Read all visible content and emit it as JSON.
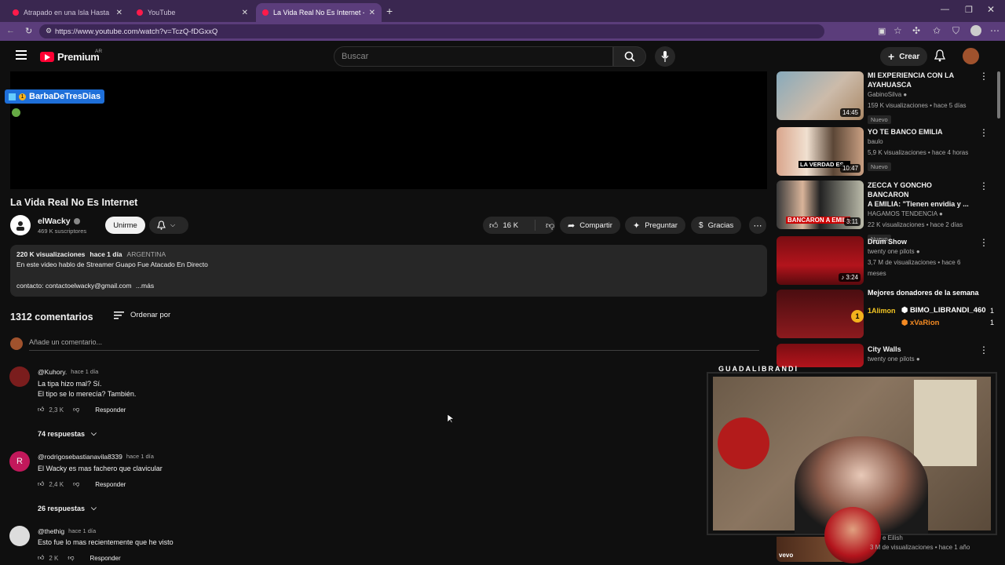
{
  "browser": {
    "tabs": [
      {
        "label": "Atrapado en una Isla Hasta que C"
      },
      {
        "label": "YouTube"
      },
      {
        "label": "La Vida Real No Es Internet - YouT"
      }
    ],
    "url": "https://www.youtube.com/watch?v=TczQ-fDGxxQ"
  },
  "header": {
    "brand": "Premium",
    "region": "AR",
    "search_placeholder": "Buscar",
    "create_label": "Crear"
  },
  "overlay": {
    "stream_name": "BarbaDeTresDias",
    "badge_num": "1",
    "webcam_title": "GUADALIBRANDI"
  },
  "video": {
    "title": "La Vida Real No Es Internet",
    "channel": "elWacky",
    "subscribers": "469 K suscriptores",
    "join_label": "Unirme",
    "likes": "16 K",
    "share_label": "Compartir",
    "ask_label": "Preguntar",
    "thanks_label": "Gracias"
  },
  "description": {
    "views": "220 K visualizaciones",
    "date": "hace 1 día",
    "country": "ARGENTINA",
    "line1": "En este video hablo de Streamer Guapo Fue Atacado En Directo",
    "line2": "contacto: contactoelwacky@gmail.com",
    "more": "...más"
  },
  "comments": {
    "count_label": "1312 comentarios",
    "sort_label": "Ordenar por",
    "add_placeholder": "Añade un comentario...",
    "reply_label": "Responder",
    "items": [
      {
        "author": "@Kuhory.",
        "time": "hace 1 día",
        "lines": [
          "La tipa hizo mal? Sí.",
          "El tipo se lo merecía? También."
        ],
        "likes": "2,3 K",
        "replies": "74 respuestas"
      },
      {
        "author": "@rodrigosebastianavila8339",
        "time": "hace 1 día",
        "lines": [
          "El Wacky es mas fachero que clavicular"
        ],
        "likes": "2,4 K",
        "replies": "26 respuestas"
      },
      {
        "author": "@thethig",
        "time": "hace 1 día",
        "lines": [
          "Esto fue lo mas recientemente que he visto"
        ],
        "likes": "2 K",
        "replies": ""
      }
    ]
  },
  "recommendations": [
    {
      "title1": "MI EXPERIENCIA CON LA",
      "title2": "AYAHUASCA",
      "channel": "GabinoSilva",
      "meta": "159 K visualizaciones • hace 5 días",
      "badge": "Nuevo",
      "duration": "14:45"
    },
    {
      "title1": "YO TE BANCO EMILIA",
      "title2": "",
      "channel": "baulo",
      "meta": "5,9 K visualizaciones • hace 4 horas",
      "badge": "Nuevo",
      "duration": "10:47",
      "thumb_text": "LA VERDAD ES..."
    },
    {
      "title1": "ZECCA Y GONCHO BANCARON",
      "title2": "A EMILIA: \"Tienen envidia y ...",
      "channel": "HAGAMOS TENDENCIA",
      "meta": "22 K visualizaciones • hace 2 días",
      "badge": "Nuevo",
      "duration": "3:11",
      "thumb_text": "BANCARON A EMILI"
    },
    {
      "title1": "Drum Show",
      "title2": "",
      "channel": "twenty one pilots",
      "meta": "3,7 M de visualizaciones • hace 6 meses",
      "badge": "",
      "duration": "3:24"
    },
    {
      "title1": "City Walls",
      "title2": "",
      "channel": "twenty one pilots",
      "meta": "",
      "badge": "",
      "duration": ""
    }
  ],
  "donors": {
    "title": "Mejores donadores de la semana",
    "rank": "1",
    "list": [
      {
        "name": "1Alimon",
        "amount": "1"
      },
      {
        "name": "BIMO_LIBRANDI_460",
        "amount": "1"
      },
      {
        "name": "xVaRion",
        "amount": "1"
      }
    ]
  },
  "bottom_rec": {
    "channel_fragment": "e Eilish",
    "meta": "3 M de visualizaciones • hace 1 año",
    "vevo": "vevo"
  },
  "colors": {
    "accent": "#ff0033",
    "tabbar": "#3a2750",
    "addrbar": "#5b3d7b",
    "bg": "#0f0f0f",
    "card": "#272727"
  }
}
